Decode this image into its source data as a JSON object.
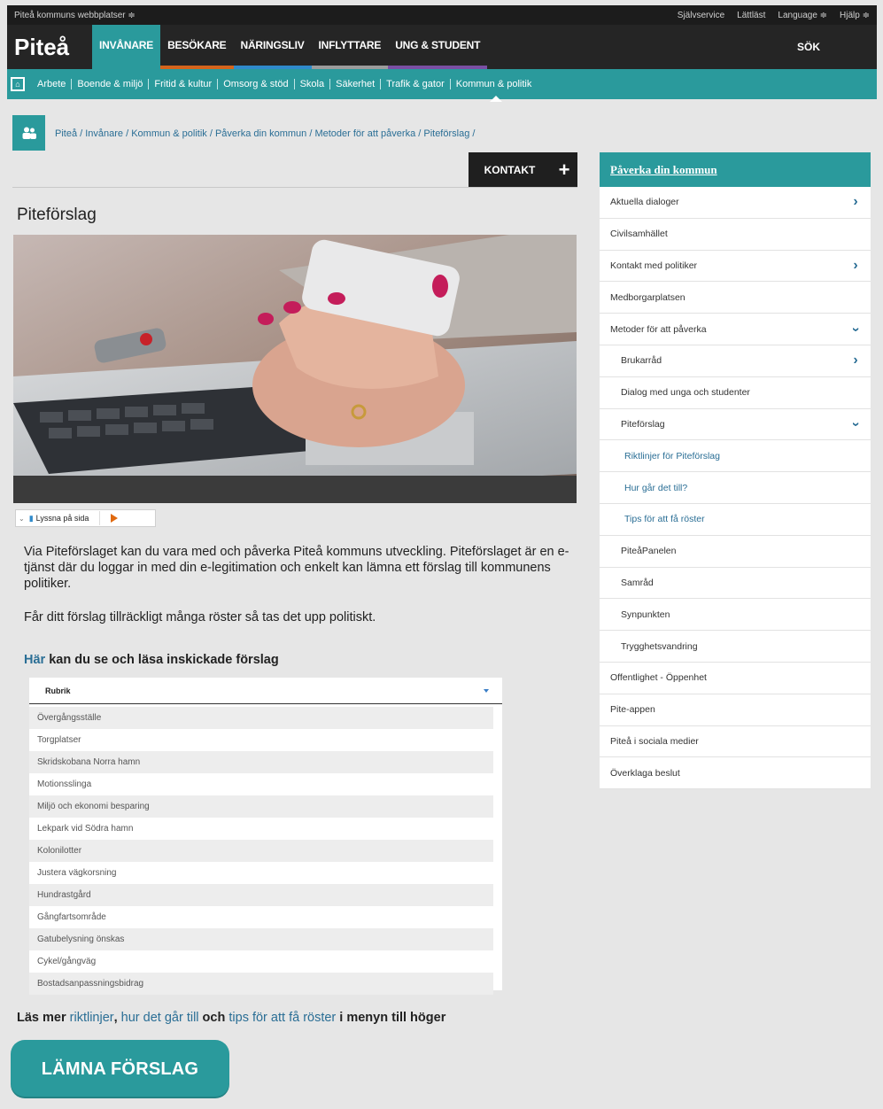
{
  "topbar": {
    "site_selector": "Piteå kommuns webbplatser ≑",
    "links": [
      "Självservice",
      "Lättläst",
      "Language ≑",
      "Hjälp ≑"
    ]
  },
  "header": {
    "logo": "Piteå",
    "tabs": [
      "INVÅNARE",
      "BESÖKARE",
      "NÄRINGSLIV",
      "INFLYTTARE",
      "UNG & STUDENT"
    ],
    "search": "SÖK"
  },
  "subnav": {
    "items": [
      "Arbete",
      "Boende & miljö",
      "Fritid & kultur",
      "Omsorg & stöd",
      "Skola",
      "Säkerhet",
      "Trafik & gator",
      "Kommun & politik"
    ]
  },
  "breadcrumb": "Piteå / Invånare / Kommun & politik / Påverka din kommun / Metoder för att påverka / Piteförslag /",
  "contact": {
    "label": "KONTAKT",
    "plus": "+"
  },
  "page": {
    "title": "Piteförslag",
    "listen_label": "Lyssna på sida",
    "paragraph1": "Via Piteförslaget kan du vara med och påverka Piteå kommuns utveckling. Piteförslaget är en e-tjänst där du loggar in med din e-legitimation och enkelt kan lämna ett förslag till kommunens politiker.",
    "paragraph2": "Får ditt förslag tillräckligt många röster så tas det upp politiskt.",
    "list_heading_link": "Här",
    "list_heading_rest": " kan du se och läsa inskickade förslag",
    "select_label": "Rubrik",
    "options": [
      "Övergångsställe",
      "Torgplatser",
      "Skridskobana Norra hamn",
      "Motionsslinga",
      "Miljö och ekonomi besparing",
      "Lekpark vid Södra hamn",
      "Kolonilotter",
      "Justera vägkorsning",
      "Hundrastgård",
      "Gångfartsområde",
      "Gatubelysning önskas",
      "Cykel/gångväg",
      "Bostadsanpassningsbidrag"
    ],
    "readmore": {
      "prefix": "Läs mer ",
      "link1": "riktlinjer",
      "sep1": ", ",
      "link2": "hur det går till",
      "sep2": " och ",
      "link3": "tips för att få röster",
      "suffix": " i menyn till höger"
    },
    "cta": "LÄMNA FÖRSLAG"
  },
  "sidebar": {
    "header": "Påverka din kommun",
    "items": [
      {
        "label": "Aktuella dialoger",
        "indent": 0,
        "chev": "right"
      },
      {
        "label": "Civilsamhället",
        "indent": 0,
        "chev": ""
      },
      {
        "label": "Kontakt med politiker",
        "indent": 0,
        "chev": "right"
      },
      {
        "label": "Medborgarplatsen",
        "indent": 0,
        "chev": ""
      },
      {
        "label": "Metoder för att påverka",
        "indent": 0,
        "chev": "down"
      },
      {
        "label": "Brukarråd",
        "indent": 1,
        "chev": "right"
      },
      {
        "label": "Dialog med unga och studenter",
        "indent": 1,
        "chev": ""
      },
      {
        "label": "Piteförslag",
        "indent": 1,
        "chev": "down"
      },
      {
        "label": "Riktlinjer för Piteförslag",
        "indent": 2,
        "chev": ""
      },
      {
        "label": "Hur går det till?",
        "indent": 2,
        "chev": ""
      },
      {
        "label": "Tips för att få röster",
        "indent": 2,
        "chev": ""
      },
      {
        "label": "PiteåPanelen",
        "indent": 1,
        "chev": ""
      },
      {
        "label": "Samråd",
        "indent": 1,
        "chev": ""
      },
      {
        "label": "Synpunkten",
        "indent": 1,
        "chev": ""
      },
      {
        "label": "Trygghetsvandring",
        "indent": 1,
        "chev": ""
      },
      {
        "label": "Offentlighet - Öppenhet",
        "indent": 0,
        "chev": ""
      },
      {
        "label": "Pite-appen",
        "indent": 0,
        "chev": ""
      },
      {
        "label": "Piteå i sociala medier",
        "indent": 0,
        "chev": ""
      },
      {
        "label": "Överklaga beslut",
        "indent": 0,
        "chev": ""
      }
    ]
  },
  "colors": {
    "accent": "#2a9a9c",
    "dark": "#252525",
    "link": "#2a6e95"
  }
}
